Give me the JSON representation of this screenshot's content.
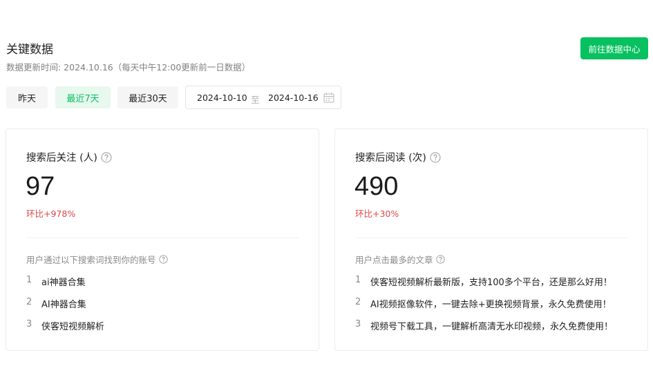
{
  "header": {
    "title": "关键数据",
    "update_time": "数据更新时间: 2024.10.16（每天中午12:00更新前一日数据）",
    "go_button": "前往数据中心"
  },
  "filters": {
    "yesterday": "昨天",
    "last7": "最近7天",
    "last30": "最近30天",
    "active": "last7",
    "date_start": "2024-10-10",
    "date_sep": "至",
    "date_end": "2024-10-16"
  },
  "cards": [
    {
      "title": "搜索后关注 (人)",
      "value": "97",
      "change": "环比+978%",
      "list_title": "用户通过以下搜索词找到你的账号",
      "items": [
        {
          "idx": "1",
          "text": "ai神器合集"
        },
        {
          "idx": "2",
          "text": "AI神器合集"
        },
        {
          "idx": "3",
          "text": "侠客短视频解析"
        }
      ]
    },
    {
      "title": "搜索后阅读 (次)",
      "value": "490",
      "change": "环比+30%",
      "list_title": "用户点击最多的文章",
      "items": [
        {
          "idx": "1",
          "text": "侠客短视频解析最新版，支持100多个平台，还是那么好用！"
        },
        {
          "idx": "2",
          "text": "AI视频抠像软件，一键去除+更换视频背景，永久免费使用！"
        },
        {
          "idx": "3",
          "text": "视频号下载工具，一键解析高清无水印视频，永久免费使用！"
        }
      ]
    }
  ],
  "colors": {
    "brand": "#07c160",
    "brand_light": "#e7f8ee",
    "change_up": "#e0454a"
  }
}
